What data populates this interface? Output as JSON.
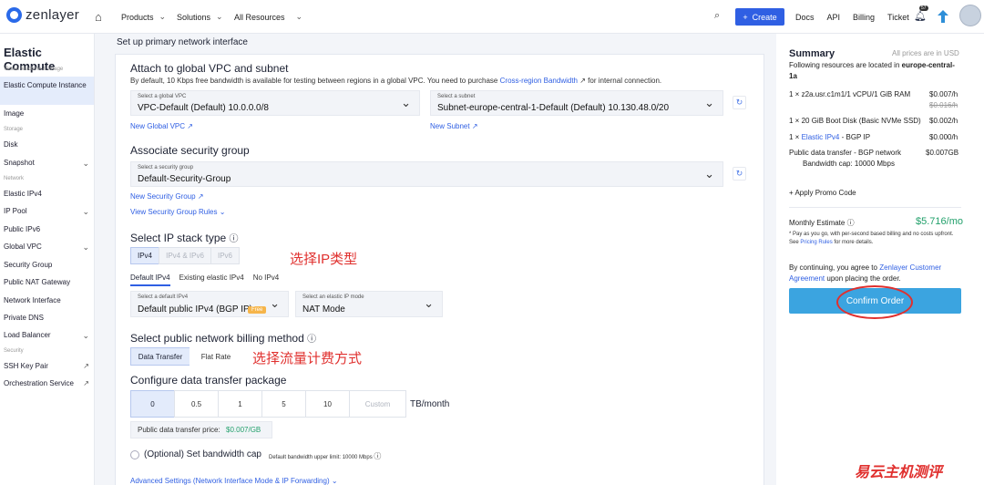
{
  "brand": {
    "name": "zenlayer"
  },
  "topnav": {
    "products": "Products",
    "solutions": "Solutions",
    "all_resources": "All Resources",
    "create": "Create",
    "docs": "Docs",
    "api": "API",
    "billing": "Billing",
    "ticket": "Ticket",
    "bell_badge": "57"
  },
  "sidebar": {
    "title": "Elastic Compute",
    "sec_vm": "Virtual Machine & Image",
    "instance": "Elastic Compute Instance",
    "image": "Image",
    "sec_storage": "Storage",
    "disk": "Disk",
    "snapshot": "Snapshot",
    "sec_network": "Network",
    "eipv4": "Elastic IPv4",
    "ippool": "IP Pool",
    "ipv6": "Public IPv6",
    "gvpc": "Global VPC",
    "sg": "Security Group",
    "nat": "Public NAT Gateway",
    "ni": "Network Interface",
    "dns": "Private DNS",
    "lb": "Load Balancer",
    "sec_security": "Security",
    "ssh": "SSH Key Pair",
    "orch": "Orchestration Service"
  },
  "main": {
    "page_title": "Set up primary network interface",
    "attach_title": "Attach to global VPC and subnet",
    "attach_desc_1": "By default, 10 Kbps free bandwidth is available for testing between regions in a global VPC. You need to purchase",
    "attach_desc_link": "Cross-region Bandwidth",
    "attach_desc_2": "for internal connection.",
    "vpc_label": "Select a global VPC",
    "vpc_value": "VPC-Default (Default) 10.0.0.0/8",
    "subnet_label": "Select a subnet",
    "subnet_value": "Subnet-europe-central-1-Default (Default) 10.130.48.0/20",
    "new_vpc": "New Global VPC",
    "new_subnet": "New Subnet",
    "sg_title": "Associate security group",
    "sg_label": "Select a security group",
    "sg_value": "Default-Security-Group",
    "new_sg": "New Security Group",
    "view_sg": "View Security Group Rules",
    "ip_title": "Select IP stack type",
    "ip_opts": [
      "IPv4",
      "IPv4 & IPv6",
      "IPv6"
    ],
    "ip_note_cn": "选择IP类型",
    "ipv4_tabs": [
      "Default IPv4",
      "Existing elastic IPv4",
      "No IPv4"
    ],
    "dipv4_label": "Select a default IPv4",
    "dipv4_value": "Default public IPv4 (BGP IP)",
    "free": "Free",
    "eip_mode_label": "Select an elastic IP mode",
    "eip_mode_value": "NAT Mode",
    "billing_title": "Select public network billing method",
    "billing_opts": [
      "Data Transfer",
      "Flat Rate"
    ],
    "billing_note_cn": "选择流量计费方式",
    "pkg_title": "Configure data transfer package",
    "pkg_opts": [
      "0",
      "0.5",
      "1",
      "5",
      "10",
      "Custom"
    ],
    "pkg_unit": "TB/month",
    "price_label": "Public data transfer price:",
    "price_value": "$0.007/GB",
    "cap_title": "(Optional) Set bandwidth cap",
    "cap_note": "Default bandwidth upper limit: 10000 Mbps",
    "advanced": "Advanced Settings (Network Interface Mode & IP Forwarding)"
  },
  "summary": {
    "title": "Summary",
    "usd_note": "All prices are in USD",
    "located": "Following resources are located in",
    "region": "europe-central-1a",
    "line1": "1 × z2a.usr.c1m1/1 vCPU/1 GiB RAM",
    "line1_price": "$0.007/h",
    "line1_strike": "$0.016/h",
    "line2": "1 × 20 GiB Boot Disk (Basic NVMe SSD)",
    "line2_price": "$0.002/h",
    "line3_pre": "1 ×",
    "line3_link": "Elastic IPv4",
    "line3_post": "- BGP IP",
    "line3_price": "$0.000/h",
    "line4": "Public data transfer - BGP network",
    "line4_price": "$0.007GB",
    "line4_cap": "Bandwidth cap: 10000 Mbps",
    "promo": "+ Apply Promo Code",
    "monthly_label": "Monthly Estimate",
    "monthly_value": "$5.716/mo",
    "fine": "* Pay as you go, with per-second based billing and no costs upfront. See",
    "fine_link": "Pricing Rules",
    "fine_tail": "for more details.",
    "agree_1": "By continuing, you agree to",
    "agree_link": "Zenlayer Customer Agreement",
    "agree_2": "upon placing the order.",
    "confirm": "Confirm Order"
  },
  "watermark": "易云主机测评"
}
